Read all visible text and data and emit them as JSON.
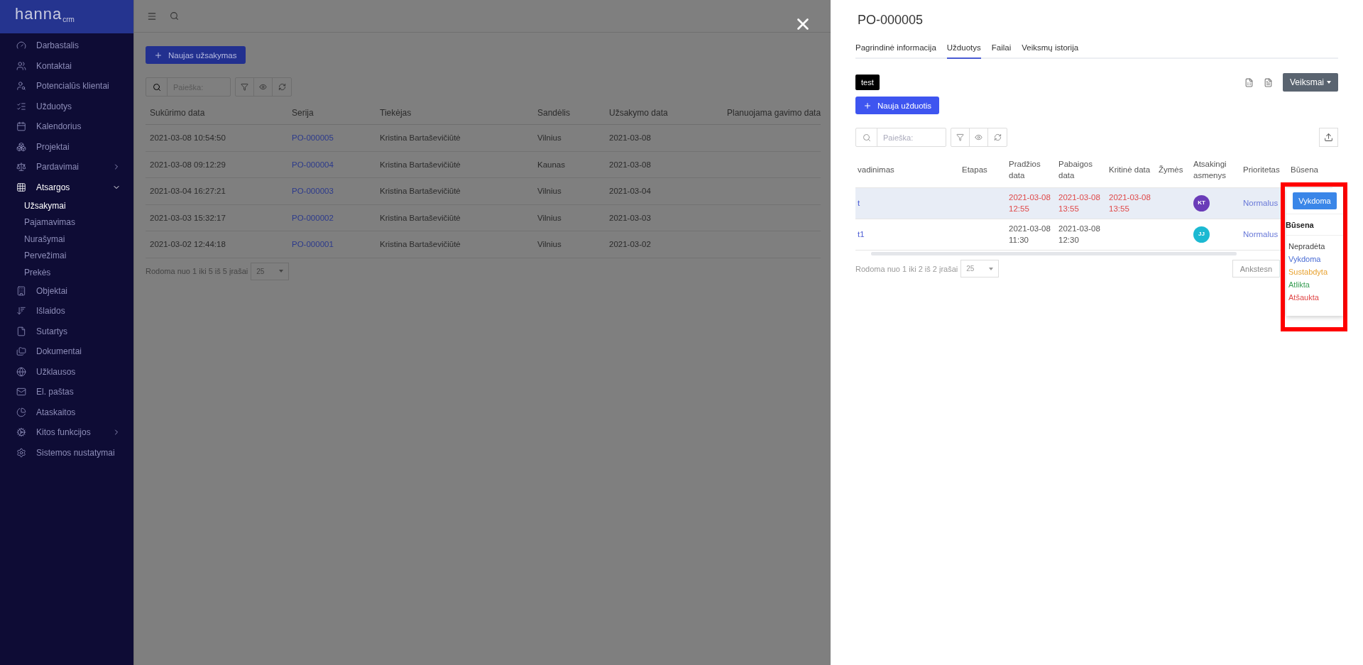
{
  "sidebar": {
    "logo": {
      "name": "hanna",
      "suffix": "crm"
    },
    "items": [
      {
        "label": "Darbastalis"
      },
      {
        "label": "Kontaktai"
      },
      {
        "label": "Potencialūs klientai"
      },
      {
        "label": "Užduotys"
      },
      {
        "label": "Kalendorius"
      },
      {
        "label": "Projektai"
      },
      {
        "label": "Pardavimai",
        "expanded": false
      },
      {
        "label": "Atsargos",
        "expanded": true,
        "children": [
          {
            "label": "Užsakymai",
            "selected": true
          },
          {
            "label": "Pajamavimas",
            "selected": false
          },
          {
            "label": "Nurašymai",
            "selected": false
          },
          {
            "label": "Pervežimai",
            "selected": false
          },
          {
            "label": "Prekės",
            "selected": false
          }
        ]
      },
      {
        "label": "Objektai"
      },
      {
        "label": "Išlaidos"
      },
      {
        "label": "Sutartys"
      },
      {
        "label": "Dokumentai"
      },
      {
        "label": "Užklausos"
      },
      {
        "label": "El. paštas"
      },
      {
        "label": "Ataskaitos"
      },
      {
        "label": "Kitos funkcijos",
        "expanded": false
      },
      {
        "label": "Sistemos nustatymai"
      }
    ]
  },
  "main": {
    "new_button": "Naujas užsakymas",
    "search": {
      "placeholder": "Paieška:"
    },
    "table": {
      "columns": [
        "Sukūrimo data",
        "Serija",
        "Tiekėjas",
        "Sandėlis",
        "Užsakymo data",
        "Planuojama gavimo data"
      ],
      "rows": [
        [
          "2021-03-08 10:54:50",
          "PO-000005",
          "Kristina Bartaševičiūtė",
          "Vilnius",
          "2021-03-08"
        ],
        [
          "2021-03-08 09:12:29",
          "PO-000004",
          "Kristina Bartaševičiūtė",
          "Kaunas",
          "2021-03-08"
        ],
        [
          "2021-03-04 16:27:21",
          "PO-000003",
          "Kristina Bartaševičiūtė",
          "Vilnius",
          "2021-03-04"
        ],
        [
          "2021-03-03 15:32:17",
          "PO-000002",
          "Kristina Bartaševičiūtė",
          "Vilnius",
          "2021-03-03"
        ],
        [
          "2021-03-02 12:44:18",
          "PO-000001",
          "Kristina Bartaševičiūtė",
          "Vilnius",
          "2021-03-02"
        ]
      ]
    },
    "footer": "Rodoma nuo 1 iki 5 iš 5 įrašai",
    "page_size": "25"
  },
  "drawer": {
    "title": "PO-000005",
    "tabs": [
      {
        "label": "Pagrindinė informacija",
        "selected": false
      },
      {
        "label": "Užduotys",
        "selected": true
      },
      {
        "label": "Failai",
        "selected": false
      },
      {
        "label": "Veiksmų istorija",
        "selected": false
      }
    ],
    "tag": "test",
    "actions_button": "Veiksmai",
    "new_button": "Nauja užduotis",
    "search": {
      "placeholder": "Paieška:"
    },
    "table": {
      "columns": [
        "vadinimas",
        "Etapas",
        "Pradžios data",
        "Pabaigos data",
        "Kritinė data",
        "Žymės",
        "Atsakingi asmenys",
        "Prioritetas",
        "Būsena"
      ],
      "rows": [
        {
          "name": "t",
          "selected": true,
          "overdue": true,
          "start": "2021-03-08 12:55",
          "end": "2021-03-08 13:55",
          "critical": "2021-03-08 13:55",
          "assignee": {
            "initials": "KT",
            "color": "#6a3cb8"
          },
          "priority": "Normalus",
          "status": "Vykdoma"
        },
        {
          "name": "t1",
          "selected": false,
          "overdue": false,
          "start": "2021-03-08 11:30",
          "end": "2021-03-08 12:30",
          "assignee": {
            "initials": "JJ",
            "color": "#1cb9d2"
          },
          "priority": "Normalus"
        }
      ]
    },
    "footer": "Rodoma nuo 1 iki 2 iš 2 įrašai",
    "page_size": "25",
    "prev_button": "Ankstesn",
    "status_menu": {
      "heading": "Būsena",
      "options": [
        {
          "label": "Nepradėta",
          "color": "#444444"
        },
        {
          "label": "Vykdoma",
          "color": "#4a6cd4"
        },
        {
          "label": "Sustabdyta",
          "color": "#e8a230"
        },
        {
          "label": "Atlikta",
          "color": "#3a9e55"
        },
        {
          "label": "Atšaukta",
          "color": "#e04848"
        }
      ]
    }
  }
}
